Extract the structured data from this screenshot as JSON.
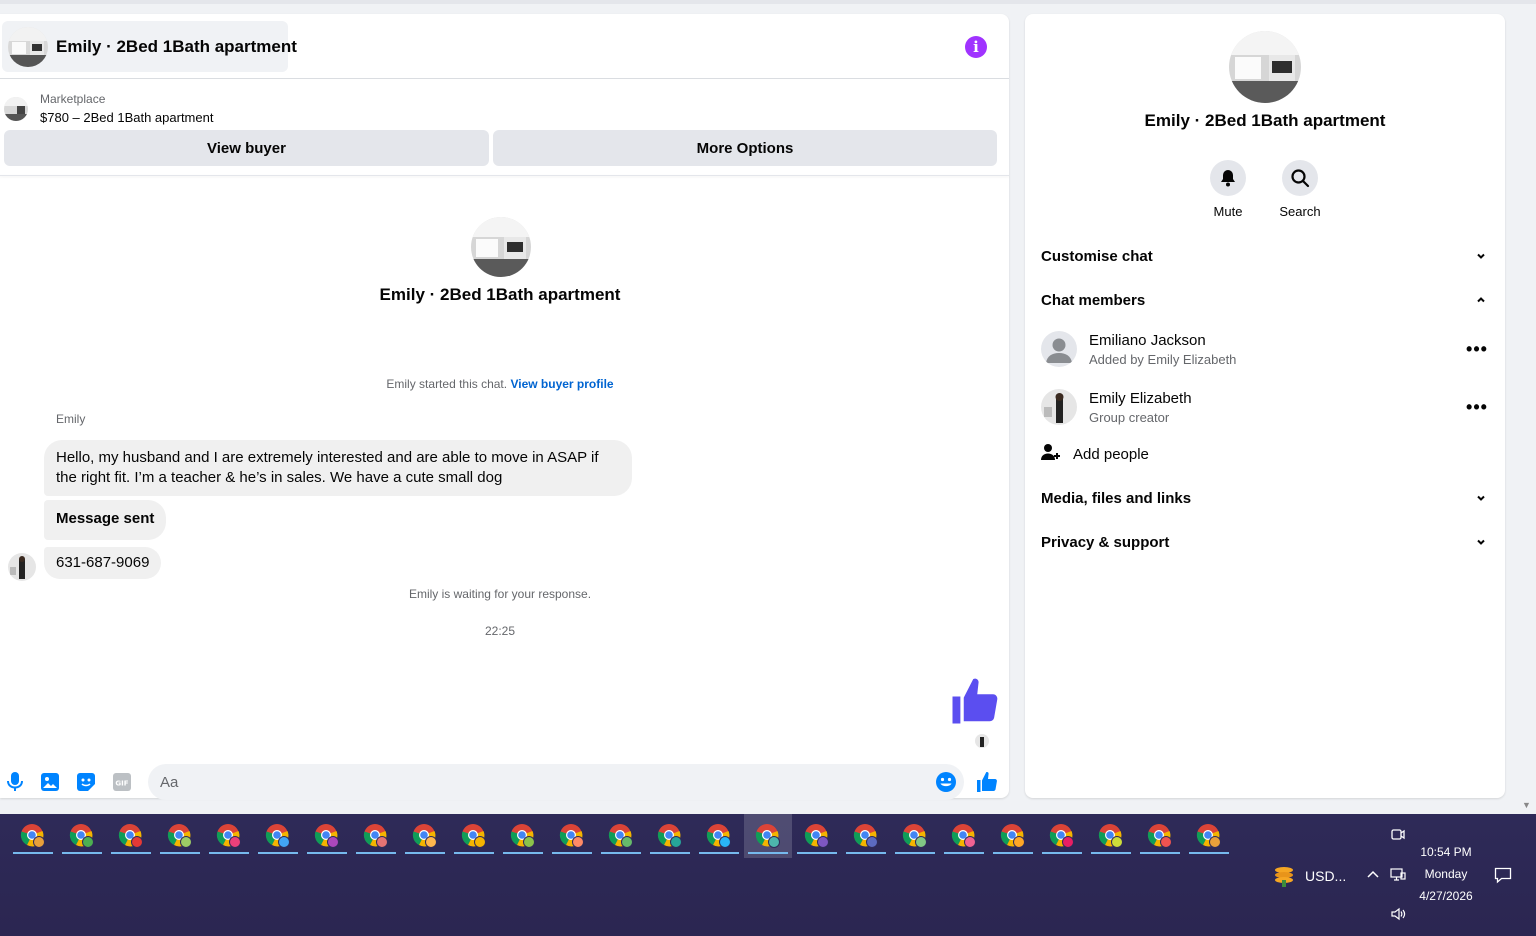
{
  "header": {
    "title": "Emily · 2Bed 1Bath apartment"
  },
  "marketplace": {
    "label": "Marketplace",
    "listing": "$780 – 2Bed 1Bath apartment"
  },
  "actions": {
    "view_buyer": "View buyer",
    "more_options": "More Options"
  },
  "conversation": {
    "title": "Emily · 2Bed 1Bath apartment",
    "started_text": "Emily started this chat.",
    "view_profile_link": "View buyer profile",
    "sender": "Emily",
    "messages": [
      "Hello, my husband and I are extremely interested and are able to move in ASAP if the right fit. I’m a teacher & he’s in sales. We have a cute small dog",
      "Message sent",
      "631-687-9069"
    ],
    "waiting_text": "Emily is waiting for your response.",
    "timestamp": "22:25"
  },
  "composer": {
    "placeholder": "Aa"
  },
  "right_panel": {
    "title": "Emily · 2Bed 1Bath apartment",
    "mute_label": "Mute",
    "search_label": "Search",
    "customise_chat": "Customise chat",
    "chat_members": "Chat members",
    "members": [
      {
        "name": "Emiliano Jackson",
        "sub": "Added by Emily Elizabeth"
      },
      {
        "name": "Emily Elizabeth",
        "sub": "Group creator"
      }
    ],
    "add_people": "Add people",
    "media": "Media, files and links",
    "privacy": "Privacy & support"
  },
  "taskbar": {
    "tray_app": "USD...",
    "time": "10:54 PM",
    "day": "Monday",
    "date": "4/27/2026"
  },
  "colors": {
    "accent": "#0084ff",
    "like": "#5b4ef0",
    "info": "#a033ff",
    "taskbar": "#2e2a58"
  }
}
